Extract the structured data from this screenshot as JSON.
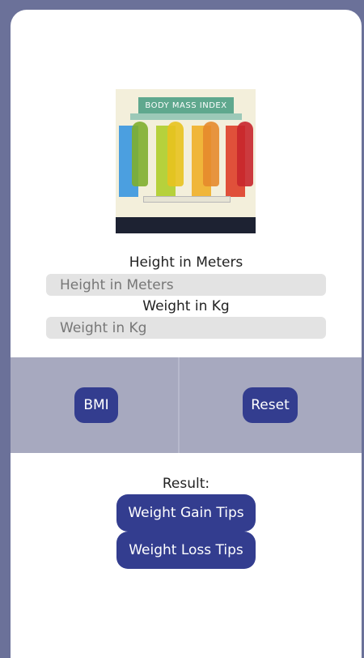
{
  "image": {
    "banner_text": "BODY MASS INDEX",
    "icon": "bmi-chart-image"
  },
  "height": {
    "label": "Height in Meters",
    "placeholder": "Height in Meters",
    "value": ""
  },
  "weight": {
    "label": "Weight in Kg",
    "placeholder": "Weight in Kg",
    "value": ""
  },
  "buttons": {
    "bmi": "BMI",
    "reset": "Reset"
  },
  "result": {
    "label": "Result:"
  },
  "tips": {
    "gain": "Weight Gain Tips",
    "loss": "Weight Loss Tips"
  },
  "colors": {
    "accent": "#333d8f",
    "panel": "#a7a9bf",
    "frame": "#6b7199"
  }
}
